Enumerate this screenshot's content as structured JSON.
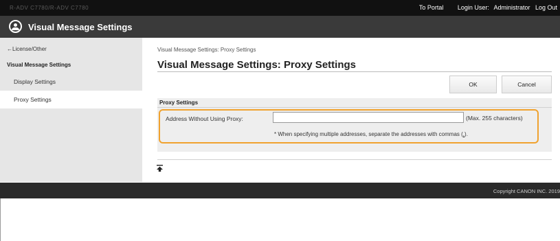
{
  "topbar": {
    "device_name": "R-ADV C7780/R-ADV C7780",
    "portal_link": "To Portal",
    "login_user_label": "Login User:",
    "login_user_name": "Administrator",
    "logout_link": "Log Out"
  },
  "titlebar": {
    "icon": "visual-message-icon",
    "title": "Visual Message Settings"
  },
  "sidebar": {
    "back_link": "License/Other",
    "section_title": "Visual Message Settings",
    "items": [
      {
        "label": "Display Settings"
      },
      {
        "label": "Proxy Settings",
        "selected": true
      }
    ]
  },
  "main": {
    "breadcrumb": "Visual Message Settings: Proxy Settings",
    "page_title": "Visual Message Settings: Proxy Settings",
    "ok_label": "OK",
    "cancel_label": "Cancel",
    "panel": {
      "header": "Proxy Settings",
      "field_label": "Address Without Using Proxy:",
      "field_value": "",
      "field_hint": "(Max. 255 characters)",
      "note_text": "* When specifying multiple addresses, separate the addresses with commas (",
      "note_comma": ",",
      "note_end": ")."
    },
    "back_to_top_icon": "arrow-up-to-top-icon"
  },
  "footer": {
    "copyright": "Copyright CANON INC. 2019"
  },
  "colors": {
    "highlight": "#f0a22e",
    "topbar": "#111111",
    "titlebar": "#3a3a3a",
    "sidebar": "#e6e6e6"
  }
}
